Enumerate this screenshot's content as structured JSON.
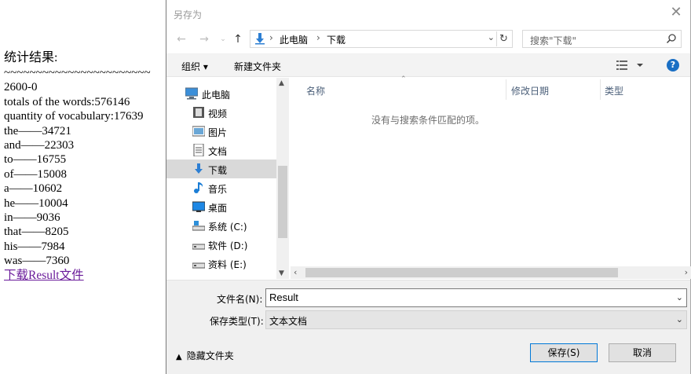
{
  "webpage": {
    "title": "统计结果:",
    "separator": "~~~~~~~~~~~~~~~~~~~~~~~",
    "lines": [
      "2600-0",
      "totals of the words:576146",
      "quantity of vocabulary:17639",
      "the——34721",
      "and——22303",
      "to——16755",
      "of——15008",
      "a——10602",
      "he——10004",
      "in——9036",
      "that——8205",
      "his——7984",
      "was——7360"
    ],
    "download_link": "下载Result文件"
  },
  "dialog": {
    "title": "另存为",
    "address": {
      "crumbs": [
        "此电脑",
        "下载"
      ]
    },
    "search_placeholder": "搜索\"下载\"",
    "toolbar": {
      "organize": "组织 ▾",
      "new_folder": "新建文件夹",
      "help": "?"
    },
    "nav_items": [
      {
        "label": "此电脑",
        "icon": "computer-icon"
      },
      {
        "label": "视频",
        "icon": "video-icon"
      },
      {
        "label": "图片",
        "icon": "pictures-icon"
      },
      {
        "label": "文档",
        "icon": "documents-icon"
      },
      {
        "label": "下载",
        "icon": "download-icon"
      },
      {
        "label": "音乐",
        "icon": "music-icon"
      },
      {
        "label": "桌面",
        "icon": "desktop-icon"
      },
      {
        "label": "系统 (C:)",
        "icon": "drive-icon"
      },
      {
        "label": "软件 (D:)",
        "icon": "drive-icon"
      },
      {
        "label": "资料 (E:)",
        "icon": "drive-icon"
      }
    ],
    "columns": [
      "名称",
      "修改日期",
      "类型"
    ],
    "empty_message": "没有与搜索条件匹配的项。",
    "filename_label": "文件名(N):",
    "filename_value": "Result",
    "filetype_label": "保存类型(T):",
    "filetype_value": "文本文档",
    "hide_folders": "隐藏文件夹",
    "save_button": "保存(S)",
    "cancel_button": "取消"
  }
}
